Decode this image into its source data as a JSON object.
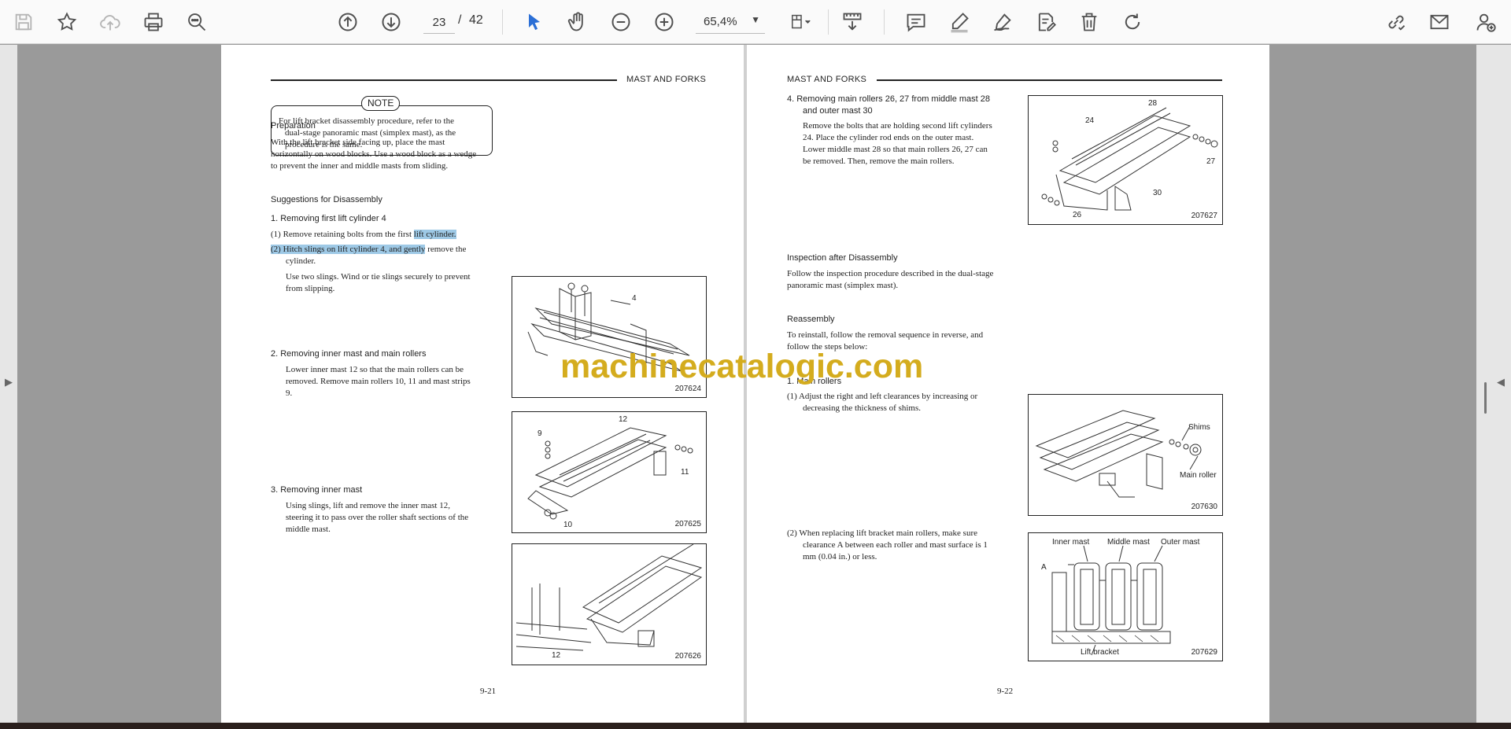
{
  "toolbar": {
    "current_page": "23",
    "page_separator": "/",
    "total_pages": "42",
    "zoom": "65,4%"
  },
  "left_page": {
    "header": "MAST AND FORKS",
    "note_label": "NOTE",
    "note_lines": [
      "For lift bracket disassembly procedure, refer to the",
      "dual-stage panoramic mast (simplex mast), as the",
      "procedure is the same."
    ],
    "preparation_title": "Preparation",
    "preparation_lines": [
      "With the lift bracket side facing up, place the mast",
      "horizontally on wood blocks.  Use a wood block as a wedge",
      "to prevent the inner and middle masts from sliding."
    ],
    "suggestions_title": "Suggestions for Disassembly",
    "step1_title": "1.   Removing first lift cylinder 4",
    "step1_sub1_prefix": "(1)  Remove retaining bolts from the first ",
    "step1_sub1_hl": "lift cylinder.",
    "step1_sub2_hl": "(2)  Hitch slings on lift cylinder 4, and gently",
    "step1_sub2_rest": " remove the",
    "step1_sub2_line2": "cylinder.",
    "step1_note_lines": [
      "Use two slings.  Wind or tie slings securely to prevent",
      "from slipping."
    ],
    "step2_title": "2.   Removing inner mast and main rollers",
    "step2_lines": [
      "Lower inner mast 12 so that the main rollers can be",
      "removed.  Remove main rollers 10, 11 and mast strips",
      "9."
    ],
    "step3_title": "3.   Removing inner mast",
    "step3_lines": [
      "Using slings, lift and remove the inner mast 12,",
      "steering it to pass over the roller shaft sections of the",
      "middle mast."
    ],
    "fig1_code": "207624",
    "fig1_label": "4",
    "fig2_code": "207625",
    "fig2_labels": [
      "12",
      "9",
      "11",
      "10"
    ],
    "fig3_code": "207626",
    "fig3_label": "12",
    "page_number": "9-21"
  },
  "right_page": {
    "header": "MAST AND FORKS",
    "step4_title_lines": [
      "4.   Removing main rollers 26, 27 from middle mast 28",
      "and outer mast 30"
    ],
    "step4_lines": [
      "Remove the bolts that are holding second lift cylinders",
      "24.  Place the cylinder rod ends on the outer mast.",
      "Lower middle mast 28 so that main rollers 26, 27 can",
      "be removed.  Then, remove the main rollers."
    ],
    "fig4_code": "207627",
    "fig4_labels": [
      "28",
      "24",
      "27",
      "30",
      "26"
    ],
    "inspection_title": "Inspection after Disassembly",
    "inspection_lines": [
      "Follow the inspection procedure described in the dual-stage",
      "panoramic mast (simplex mast)."
    ],
    "reassembly_title": "Reassembly",
    "reassembly_lines": [
      "To reinstall, follow the removal sequence in reverse, and",
      "follow the steps below:"
    ],
    "main_rollers_title": "1.   Main rollers",
    "mr1_lines": [
      "(1)  Adjust the right and left clearances by increasing or",
      "decreasing the thickness of shims."
    ],
    "fig5_code": "207630",
    "fig5_labels": [
      "Shims",
      "Main roller"
    ],
    "mr2_lines": [
      "(2)  When replacing lift bracket main rollers, make sure",
      "clearance A between each roller and mast surface is 1",
      "mm (0.04 in.) or less."
    ],
    "fig6_code": "207629",
    "fig6_labels": [
      "Inner mast",
      "Middle mast",
      "Outer mast",
      "A",
      "Lift bracket"
    ],
    "page_number": "9-22"
  },
  "watermark": "machinecatalogic.com"
}
